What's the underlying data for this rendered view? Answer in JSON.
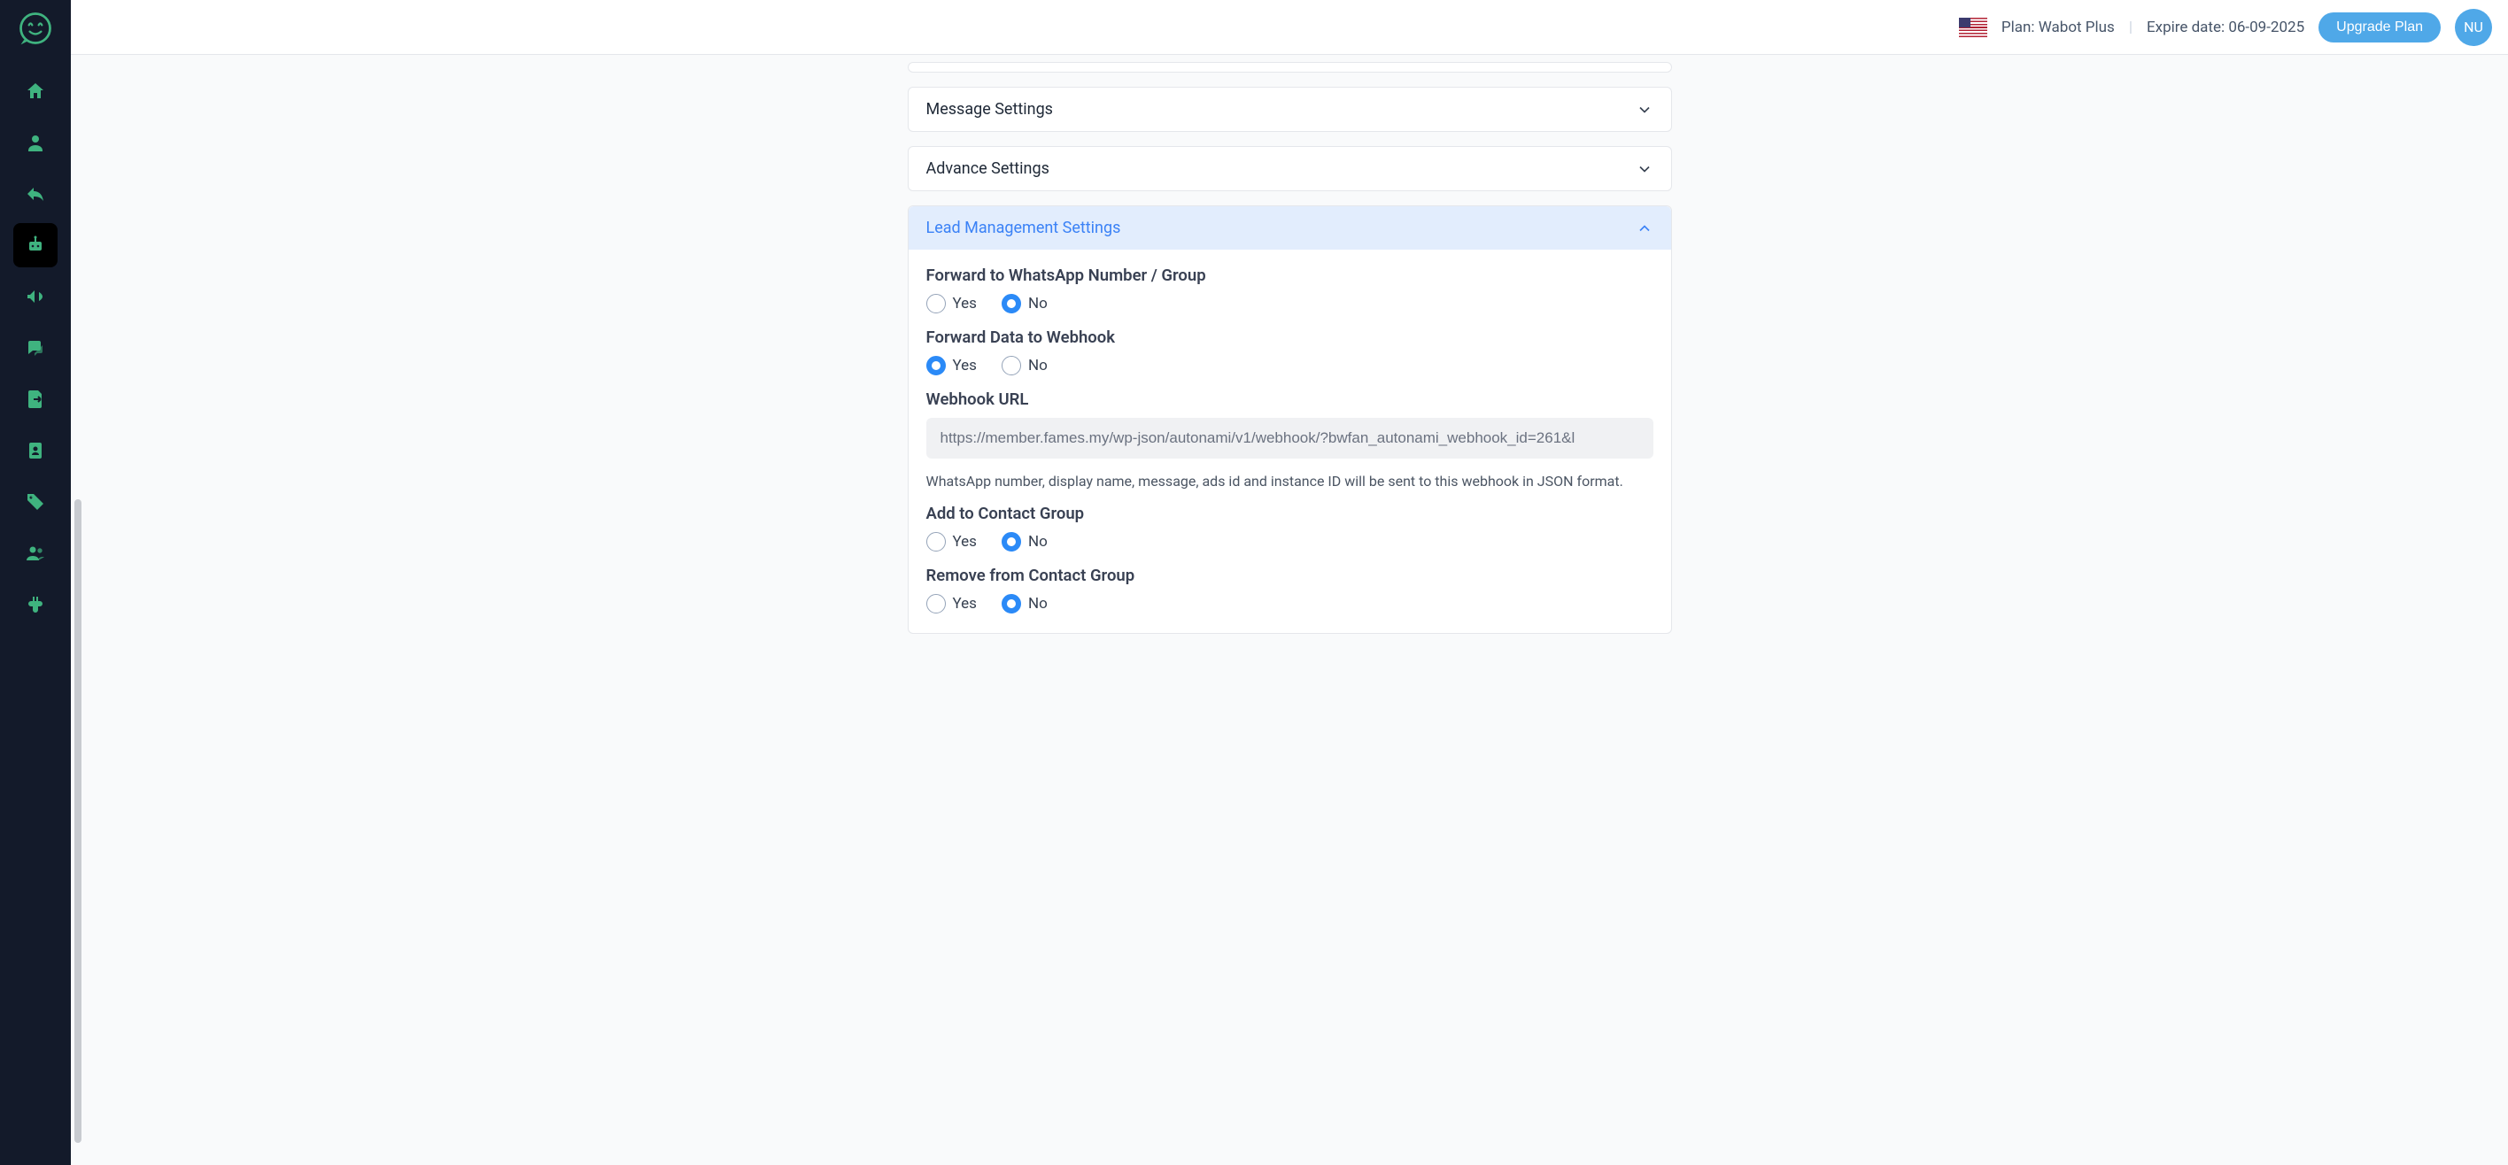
{
  "topbar": {
    "plan_label": "Plan: Wabot Plus",
    "expire_label": "Expire date: 06-09-2025",
    "upgrade_label": "Upgrade Plan",
    "avatar_initials": "NU"
  },
  "panels": {
    "message_settings": {
      "title": "Message Settings"
    },
    "advance_settings": {
      "title": "Advance Settings"
    },
    "lead_mgmt": {
      "title": "Lead Management Settings"
    }
  },
  "lead": {
    "forward_whatsapp": {
      "label": "Forward to WhatsApp Number / Group",
      "yes": "Yes",
      "no": "No",
      "value": "No"
    },
    "forward_webhook": {
      "label": "Forward Data to Webhook",
      "yes": "Yes",
      "no": "No",
      "value": "Yes"
    },
    "webhook_url": {
      "label": "Webhook URL",
      "value": "https://member.fames.my/wp-json/autonami/v1/webhook/?bwfan_autonami_webhook_id=261&l",
      "hint": "WhatsApp number, display name, message, ads id and instance ID will be sent to this webhook in JSON format."
    },
    "add_contact_group": {
      "label": "Add to Contact Group",
      "yes": "Yes",
      "no": "No",
      "value": "No"
    },
    "remove_contact_group": {
      "label": "Remove from Contact Group",
      "yes": "Yes",
      "no": "No",
      "value": "No"
    }
  }
}
